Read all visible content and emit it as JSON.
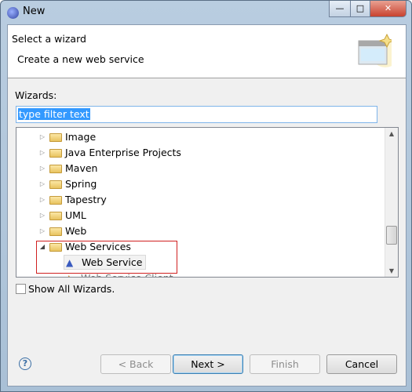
{
  "window": {
    "title": "New",
    "controls": [
      "minimize",
      "maximize",
      "close"
    ]
  },
  "header": {
    "title": "Select a wizard",
    "description": "Create a new web service"
  },
  "wizards_label": "Wizards:",
  "filter": {
    "value": "type filter text"
  },
  "tree": [
    {
      "label": "Image",
      "expanded": false
    },
    {
      "label": "Java Enterprise Projects",
      "expanded": false
    },
    {
      "label": "Maven",
      "expanded": false
    },
    {
      "label": "Spring",
      "expanded": false
    },
    {
      "label": "Tapestry",
      "expanded": false
    },
    {
      "label": "UML",
      "expanded": false
    },
    {
      "label": "Web",
      "expanded": false
    },
    {
      "label": "Web Services",
      "expanded": true
    },
    {
      "label": "Web Service",
      "selected": true
    },
    {
      "label": "Web Service Client"
    }
  ],
  "show_all": {
    "label": "Show All Wizards.",
    "checked": false
  },
  "buttons": {
    "back": "< Back",
    "next": "Next >",
    "finish": "Finish",
    "cancel": "Cancel",
    "help": "?"
  }
}
